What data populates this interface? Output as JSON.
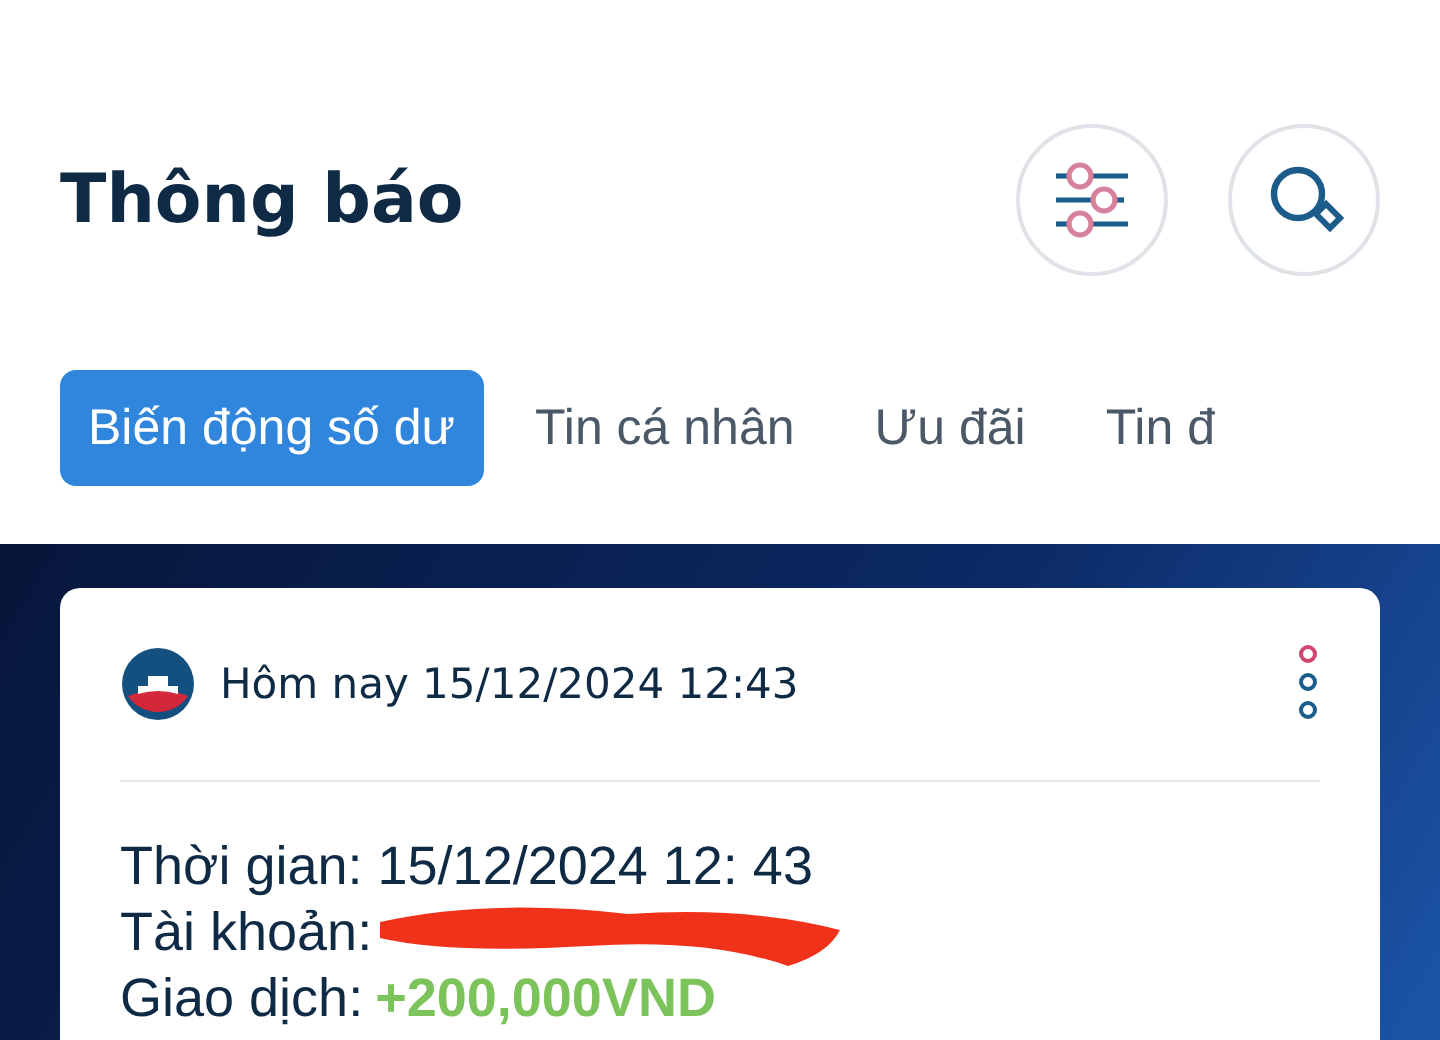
{
  "header": {
    "title": "Thông báo"
  },
  "tabs": [
    {
      "label": "Biến động số dư",
      "selected": true
    },
    {
      "label": "Tin cá nhân",
      "selected": false
    },
    {
      "label": "Ưu đãi",
      "selected": false
    },
    {
      "label": "Tin đ",
      "selected": false
    }
  ],
  "notification": {
    "timestamp": "Hôm nay 15/12/2024 12:43",
    "lines": [
      {
        "kind": "plain",
        "label": "Thời gian:",
        "value": "15/12/2024 12: 43"
      },
      {
        "kind": "redacted",
        "label": "Tài khoản:"
      },
      {
        "kind": "amount",
        "label": "Giao dịch:",
        "value": "+200,000VND"
      }
    ]
  }
}
